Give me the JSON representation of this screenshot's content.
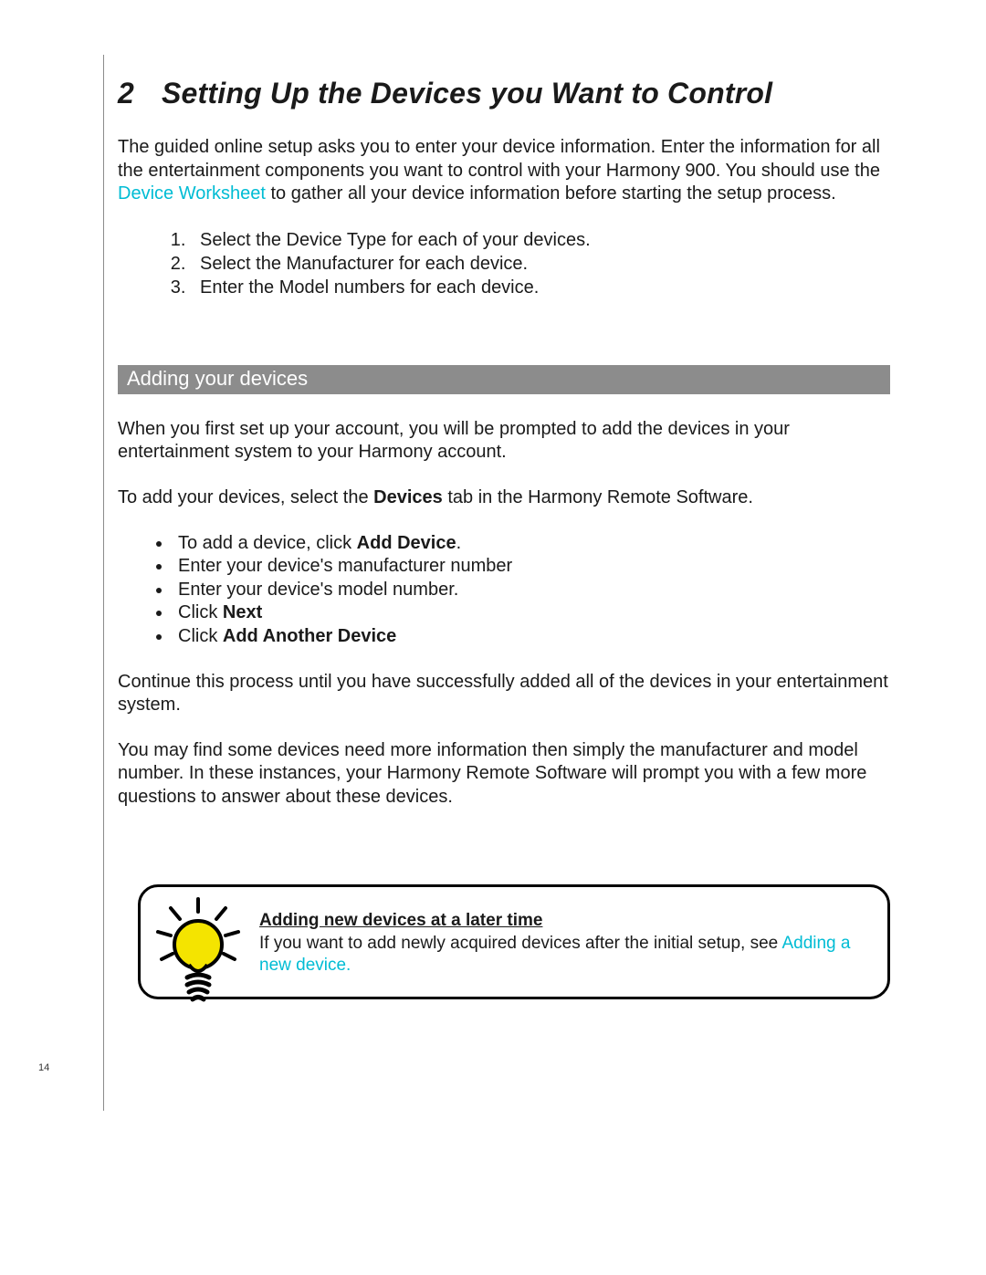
{
  "page_number": "14",
  "section": {
    "number": "2",
    "title": "Setting Up the Devices you Want to Control"
  },
  "intro": {
    "pre_link": "The guided online setup asks you to enter your device information. Enter the information for all the entertainment components you want to control with your Harmony 900. You should use the ",
    "link": "Device Worksheet",
    "post_link": " to gather all your device information before starting the setup process."
  },
  "steps": [
    "Select the Device Type for each of your devices.",
    "Select the Manufacturer for each device.",
    "Enter the Model numbers for each device."
  ],
  "subhead": "Adding your devices",
  "para1": "When you first set up your account, you will be prompted to add the devices in your entertainment system to your Harmony account.",
  "para2": {
    "pre": "To add your devices, select the ",
    "bold": "Devices",
    "post": " tab in the Harmony Remote Software."
  },
  "bullets": {
    "b1": {
      "pre": "To add a device, click ",
      "bold": "Add Device",
      "post": "."
    },
    "b2": "Enter your device's manufacturer number",
    "b3": "Enter your device's model number.",
    "b4": {
      "pre": "Click ",
      "bold": "Next"
    },
    "b5": {
      "pre": "Click ",
      "bold": "Add Another Device"
    }
  },
  "para3": "Continue this process until you have successfully added all of the devices in your entertainment system.",
  "para4": "You may find some devices need more information then simply the manufacturer and model number. In these instances, your Harmony Remote Software will prompt you with a few more questions to answer about these devices.",
  "tip": {
    "title": "Adding new devices at a later time",
    "body_pre": "If you want to add newly acquired devices after the initial setup, see ",
    "link": "Adding a new device."
  }
}
